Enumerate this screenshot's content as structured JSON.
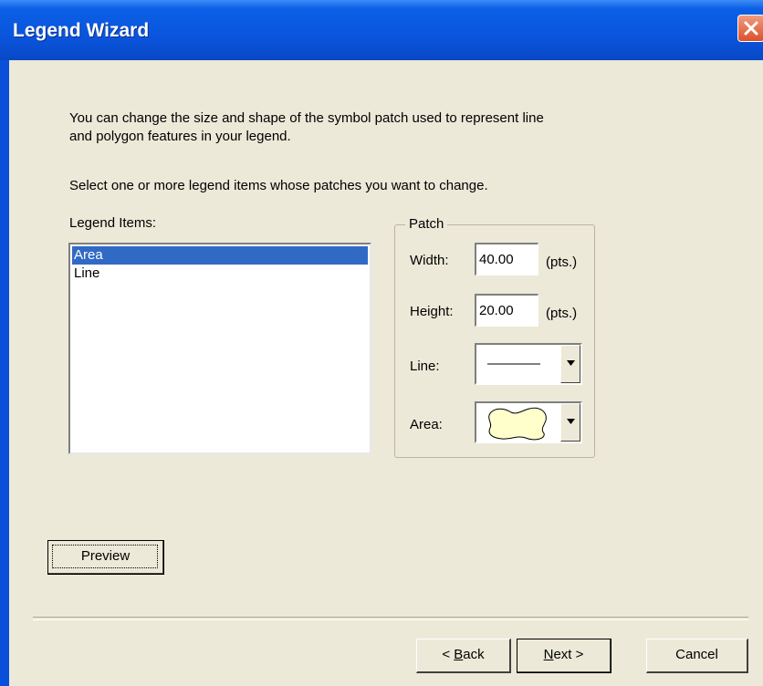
{
  "window": {
    "title": "Legend Wizard"
  },
  "intro": {
    "line1": "You can change the size and shape of the symbol patch used to represent line",
    "line2": "and polygon features in your legend."
  },
  "instruction": "Select one or more legend items whose patches you want to change.",
  "legend_items": {
    "label": "Legend Items:",
    "items": [
      {
        "label": "Area",
        "selected": true
      },
      {
        "label": "Line",
        "selected": false
      }
    ]
  },
  "patch": {
    "group_label": "Patch",
    "width": {
      "label": "Width:",
      "value": "40.00",
      "unit": "(pts.)"
    },
    "height": {
      "label": "Height:",
      "value": "20.00",
      "unit": "(pts.)"
    },
    "line": {
      "label": "Line:",
      "icon": "line-symbol-icon"
    },
    "area": {
      "label": "Area:",
      "icon": "area-patch-icon",
      "fill": "#ffffcc"
    }
  },
  "buttons": {
    "preview": "Preview",
    "back_mn": "B",
    "back_rest": "ack",
    "next_mn": "N",
    "next_rest": "ext >",
    "cancel": "Cancel"
  },
  "colors": {
    "title_bar": "#0a55dd",
    "selection": "#316ac5",
    "dialog_bg": "#ece9d8",
    "close_button": "#d8522c"
  }
}
